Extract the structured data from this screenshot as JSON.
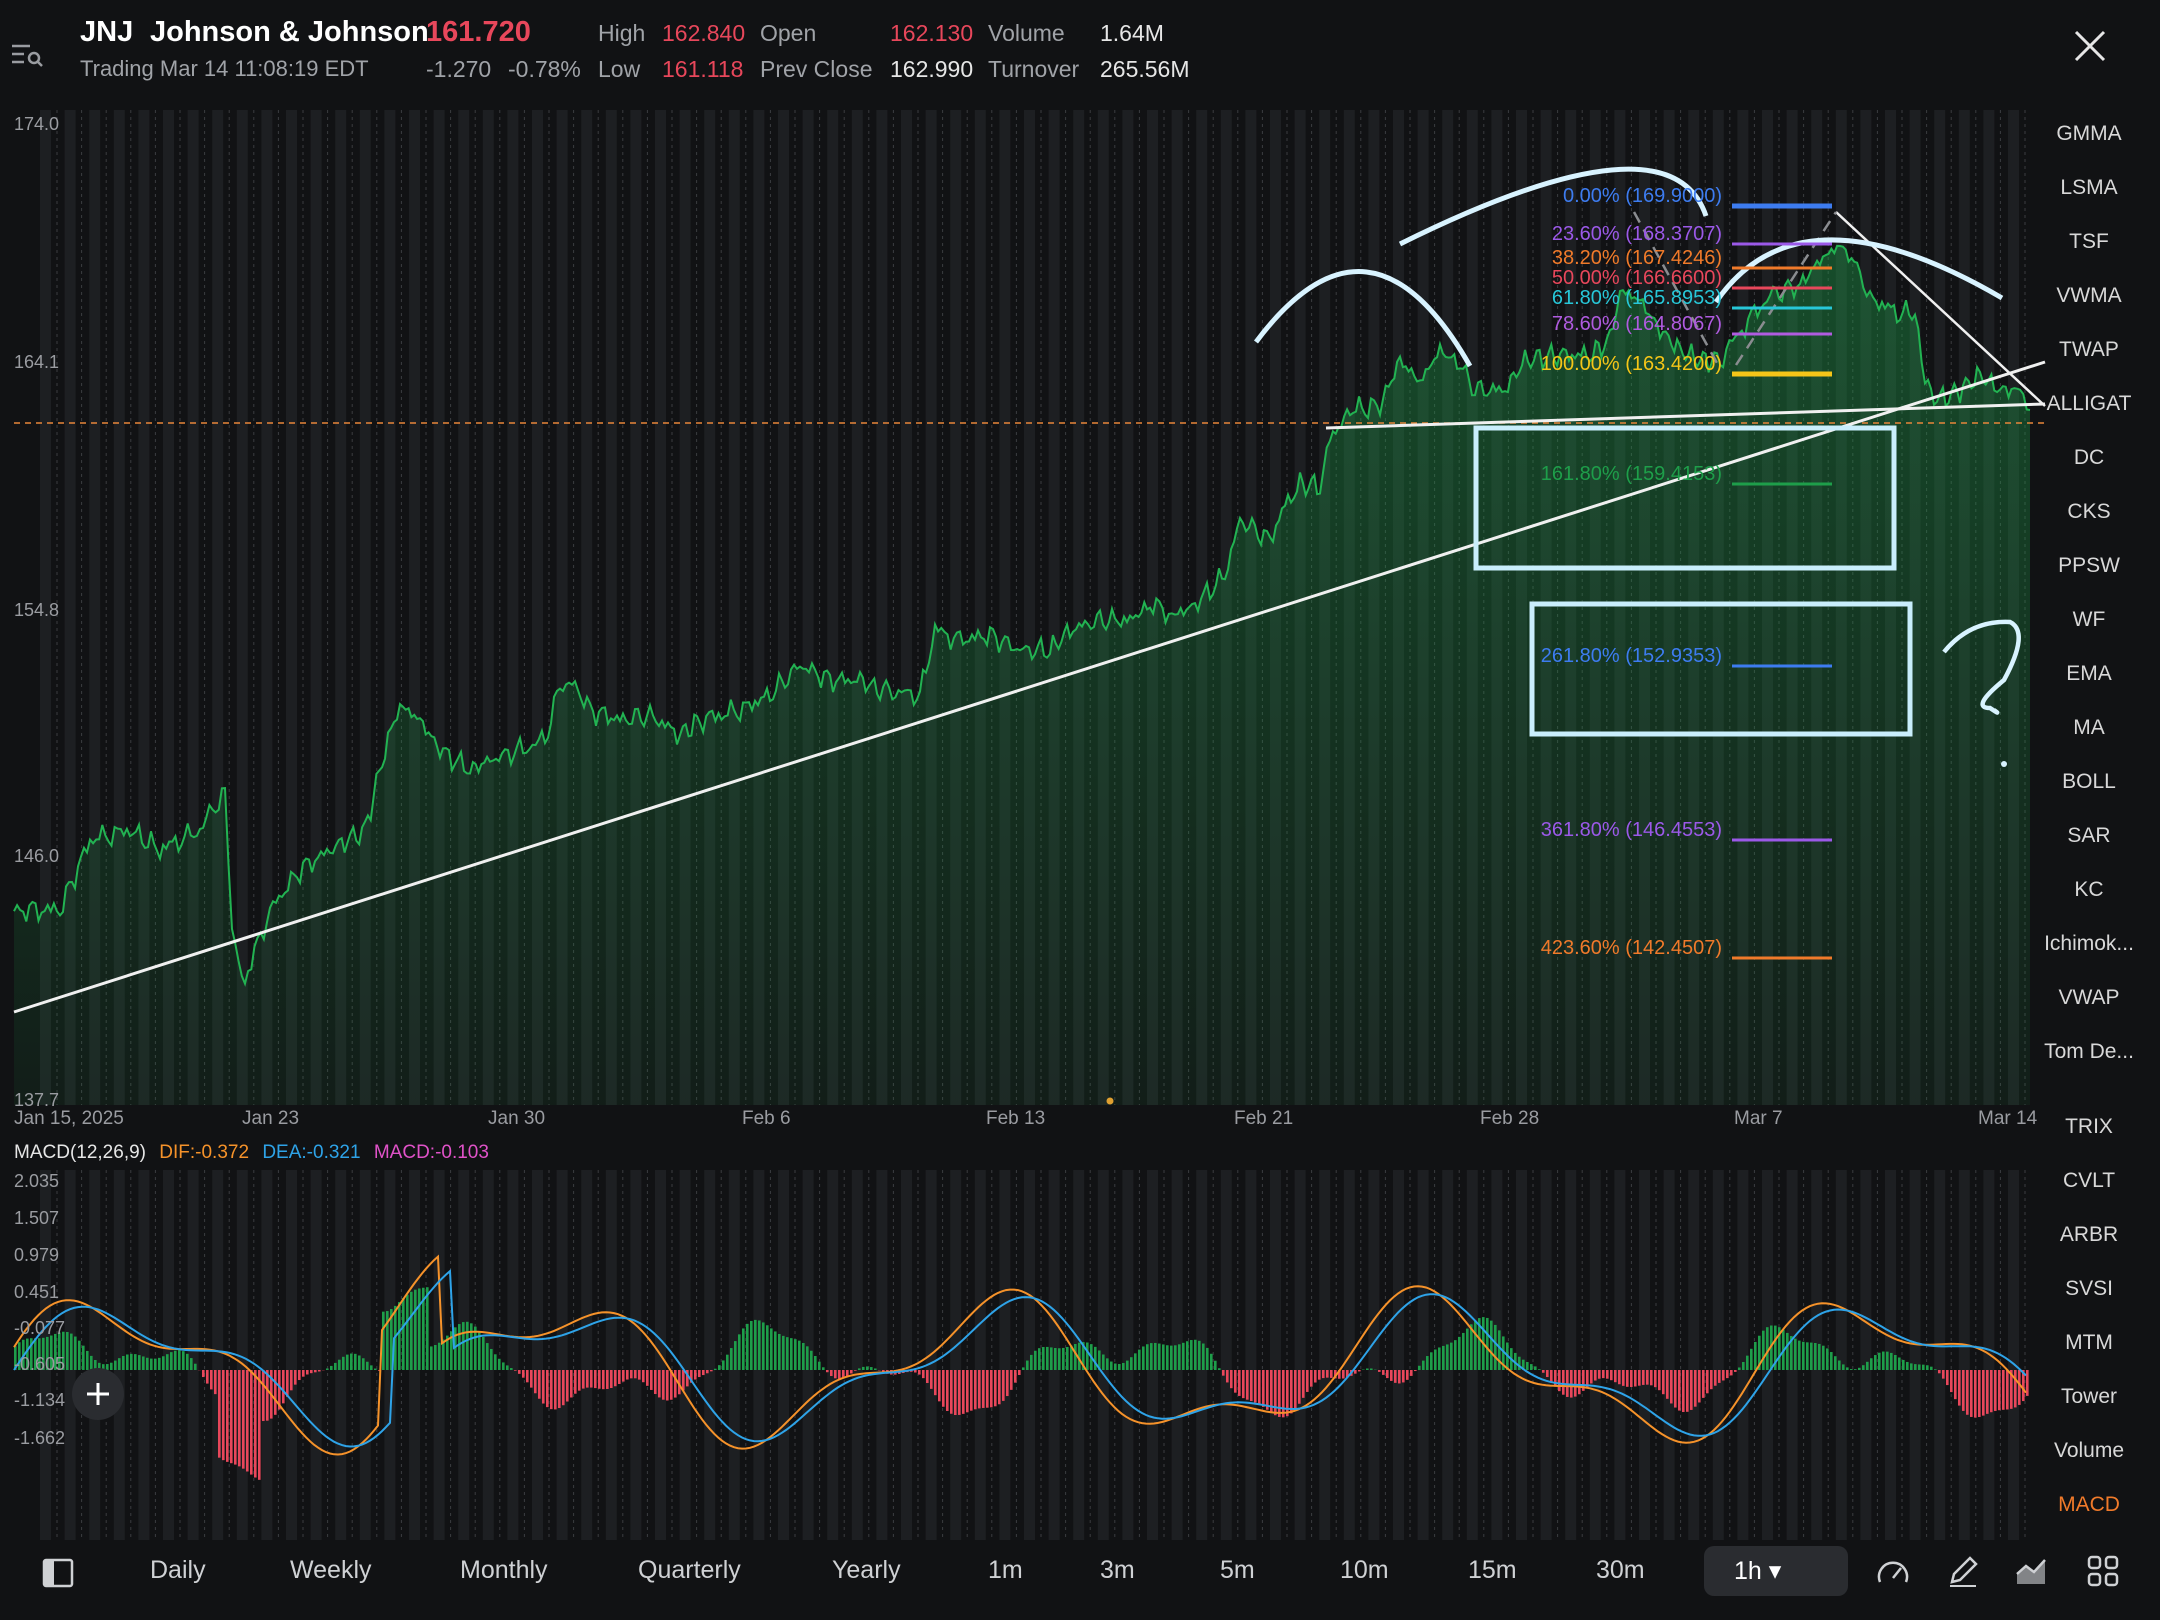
{
  "header": {
    "ticker": "JNJ",
    "company": "Johnson & Johnson",
    "price": "161.720",
    "status": "Trading Mar 14 11:08:19 EDT",
    "change": "-1.270",
    "change_pct": "-0.78%",
    "high_label": "High",
    "high": "162.840",
    "low_label": "Low",
    "low": "161.118",
    "open_label": "Open",
    "open": "162.130",
    "prev_close_label": "Prev Close",
    "prev_close": "162.990",
    "volume_label": "Volume",
    "volume": "1.64M",
    "turnover_label": "Turnover",
    "turnover": "265.56M"
  },
  "price_axis": [
    "174.0",
    "164.1",
    "154.8",
    "146.0",
    "137.7"
  ],
  "date_axis": [
    "Jan 15, 2025",
    "Jan 23",
    "Jan 30",
    "Feb 6",
    "Feb 13",
    "Feb 21",
    "Feb 28",
    "Mar 7",
    "Mar 14"
  ],
  "fib_levels": [
    {
      "label": "0.00% (169.9000)",
      "color": "#3d7cf0"
    },
    {
      "label": "23.60% (168.3707)",
      "color": "#9b59e8"
    },
    {
      "label": "38.20% (167.4246)",
      "color": "#f07a2a"
    },
    {
      "label": "50.00% (166.6600)",
      "color": "#e8475b"
    },
    {
      "label": "61.80% (165.8953)",
      "color": "#27c7d8"
    },
    {
      "label": "78.60% (164.8067)",
      "color": "#b05be0"
    },
    {
      "label": "100.00% (163.4200)",
      "color": "#f5c518"
    },
    {
      "label": "161.80% (159.4153)",
      "color": "#1e9e4a"
    },
    {
      "label": "261.80% (152.9353)",
      "color": "#3d7cf0"
    },
    {
      "label": "361.80% (146.4553)",
      "color": "#9b59e8"
    },
    {
      "label": "423.60% (142.4507)",
      "color": "#f07a2a"
    }
  ],
  "annotation_text": "?",
  "macd": {
    "title": "MACD(12,26,9)",
    "dif": "DIF:-0.372",
    "dea": "DEA:-0.321",
    "macd": "MACD:-0.103",
    "axis": [
      "2.035",
      "1.507",
      "0.979",
      "0.451",
      "-0.077",
      "-0.605",
      "-1.134",
      "-1.662"
    ],
    "colors": {
      "dif": "#f5922a",
      "dea": "#2ea3e8",
      "macd": "#e052c8"
    }
  },
  "sidebar_main": [
    "GMMA",
    "LSMA",
    "TSF",
    "VWMA",
    "TWAP",
    "ALLIGAT",
    "DC",
    "CKS",
    "PPSW",
    "WF",
    "EMA",
    "MA",
    "BOLL",
    "SAR",
    "KC",
    "Ichimok...",
    "VWAP",
    "Tom De..."
  ],
  "sidebar_sub": [
    "TRIX",
    "CVLT",
    "ARBR",
    "SVSI",
    "MTM",
    "Tower",
    "Volume",
    "MACD"
  ],
  "timeframes": [
    "Daily",
    "Weekly",
    "Monthly",
    "Quarterly",
    "Yearly",
    "1m",
    "3m",
    "5m",
    "10m",
    "15m",
    "30m"
  ],
  "active_timeframe": "1h ▾",
  "colors": {
    "up": "#1e9e4a",
    "down": "#e8475b",
    "accent": "#f07a2a"
  }
}
